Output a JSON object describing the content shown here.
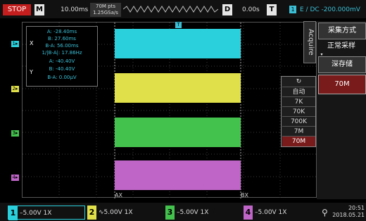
{
  "topbar": {
    "status": "STOP",
    "mode_key": "M",
    "timebase": "10.00ms",
    "memory_line1": "70M pts",
    "memory_line2": "1.25GSa/s",
    "delay_key": "D",
    "delay": "0.00s",
    "trigger_key": "T",
    "trigger_channel": "1",
    "trigger_info": "E / DC -200.000mV"
  },
  "measurement": {
    "x_label": "X",
    "a_time": "A: -28.40ms",
    "b_time": "B: 27.60ms",
    "ba_time": "B-A: 56.00ms",
    "freq": "1/|B-A|: 17.86Hz",
    "y_label": "Y",
    "a_volt": "A: -40.40V",
    "b_volt": "B: -40.40V",
    "ba_volt": "B-A: 0.00μV"
  },
  "channels": [
    {
      "num": "1",
      "color": "#2ad0dc",
      "scale": "5.00V",
      "probe": "1X",
      "coupling": "dc"
    },
    {
      "num": "2",
      "color": "#e0e04a",
      "scale": "5.00V",
      "probe": "1X",
      "coupling": "ac"
    },
    {
      "num": "3",
      "color": "#44c24e",
      "scale": "5.00V",
      "probe": "1X",
      "coupling": "dc"
    },
    {
      "num": "4",
      "color": "#c065c8",
      "scale": "5.00V",
      "probe": "1X",
      "coupling": "dc"
    }
  ],
  "bottom_values": {
    "ch1": "–5.00V 1X",
    "ch2": "∿5.00V 1X",
    "ch3": "–5.00V 1X",
    "ch4": "–5.00V 1X"
  },
  "cursors": {
    "a_label": "AX",
    "b_label": "BX"
  },
  "trigger_marker": "T",
  "acquire_menu": {
    "tab_label": "Acquire",
    "acquisition_mode_title": "采集方式",
    "acquisition_mode_value": "正常采样",
    "storage_depth_title": "深存储",
    "storage_depth_value": "70M"
  },
  "depth_options": {
    "refresh_icon": "↻",
    "items": [
      "自动",
      "7K",
      "70K",
      "700K",
      "7M",
      "70M"
    ],
    "selected": "70M"
  },
  "clock": {
    "time": "20:51",
    "date": "2018.05.21"
  },
  "icons": {
    "usb": "usb-icon"
  }
}
